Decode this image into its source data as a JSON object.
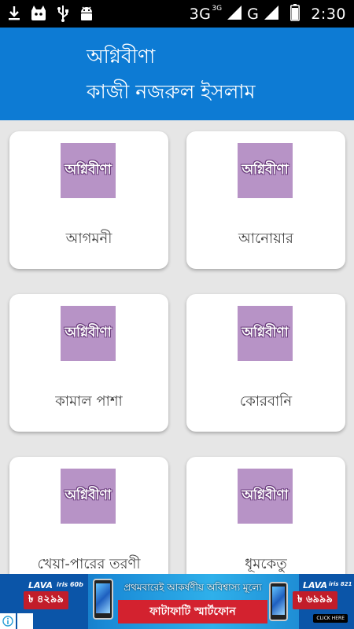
{
  "status_bar": {
    "network": "3G",
    "network_superscript": "3G",
    "network_letter": "G",
    "time": "2:30",
    "icons": [
      "download-icon",
      "cat-icon",
      "usb-icon",
      "android-icon",
      "signal-icon",
      "signal-icon",
      "battery-icon"
    ]
  },
  "app_bar": {
    "title": "অগ্নিবীণা",
    "subtitle": "কাজী নজরুল ইসলাম"
  },
  "cards": [
    {
      "thumb_text": "অগ্নিবীণা",
      "label": "আগমনী"
    },
    {
      "thumb_text": "অগ্নিবীণা",
      "label": "আনোয়ার"
    },
    {
      "thumb_text": "অগ্নিবীণা",
      "label": "কামাল পাশা"
    },
    {
      "thumb_text": "অগ্নিবীণা",
      "label": "কোরবানি"
    },
    {
      "thumb_text": "অগ্নিবীণা",
      "label": "খেয়া-পারের তরণী"
    },
    {
      "thumb_text": "অগ্নিবীণা",
      "label": "ধূমকেতু"
    }
  ],
  "ad": {
    "brand_left": "LAVA",
    "model_left": "iris 60b",
    "price_left": "৳ ৪২৯৯",
    "headline": "প্রথমবারেই আকর্ষণীয় অবিশ্বাস্য মূল্যে",
    "subline": "ফাটাফাটি স্মার্টফোন",
    "brand_right": "LAVA",
    "model_right": "iris 821",
    "price_right": "৳ ৬৯৯৯",
    "cta": "CLICK HERE",
    "info_icon": "info-icon",
    "close_icon": "close-icon"
  },
  "colors": {
    "app_bar": "#0d7bd4",
    "thumb": "#b793c6",
    "background": "#e6e6e6",
    "status_bar": "#000000"
  }
}
